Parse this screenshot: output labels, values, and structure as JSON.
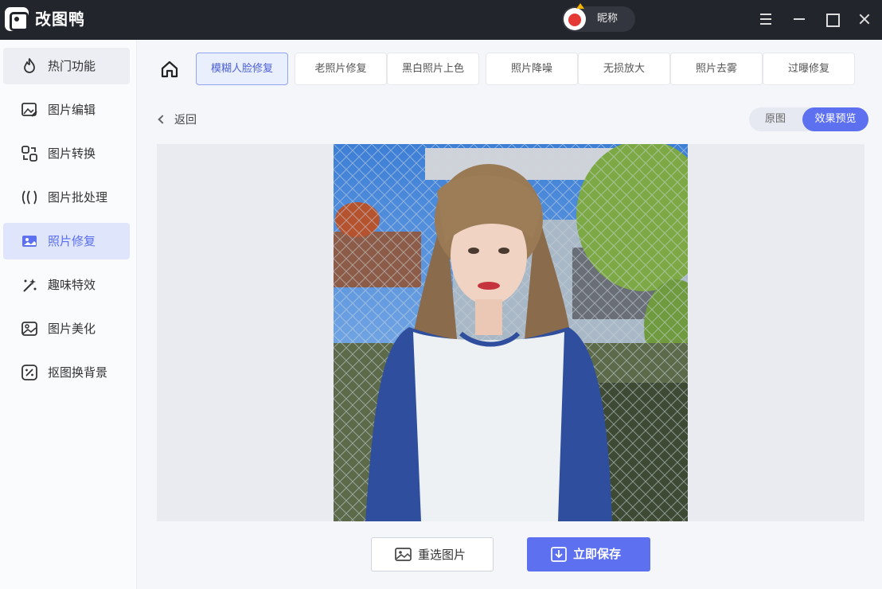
{
  "app": {
    "title": "改图鸭",
    "user_nickname": "昵称"
  },
  "sidebar": {
    "items": [
      {
        "label": "热门功能",
        "icon": "flame-icon"
      },
      {
        "label": "图片编辑",
        "icon": "image-edit-icon"
      },
      {
        "label": "图片转换",
        "icon": "convert-icon"
      },
      {
        "label": "图片批处理",
        "icon": "batch-icon"
      },
      {
        "label": "照片修复",
        "icon": "photo-repair-icon"
      },
      {
        "label": "趣味特效",
        "icon": "magic-wand-icon"
      },
      {
        "label": "图片美化",
        "icon": "beautify-icon"
      },
      {
        "label": "抠图换背景",
        "icon": "cutout-icon"
      }
    ],
    "active_index": 4
  },
  "tabs": [
    {
      "label": "模糊人脸修复"
    },
    {
      "label": "老照片修复"
    },
    {
      "label": "黑白照片上色"
    },
    {
      "label": "照片降噪"
    },
    {
      "label": "无损放大"
    },
    {
      "label": "照片去雾"
    },
    {
      "label": "过曝修复"
    }
  ],
  "active_tab_index": 0,
  "back_label": "返回",
  "view_toggle": {
    "original_label": "原图",
    "preview_label": "效果预览",
    "selected": "preview"
  },
  "actions": {
    "reselect_label": "重选图片",
    "save_label": "立即保存"
  },
  "colors": {
    "accent": "#5d70f0",
    "titlebar": "#23252d",
    "active_bg": "#dfe6fb"
  }
}
